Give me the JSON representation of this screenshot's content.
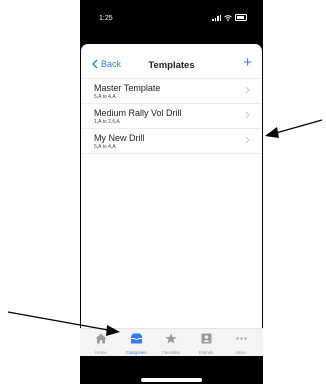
{
  "status": {
    "time": "1:25"
  },
  "nav": {
    "back_label": "Back",
    "title": "Templates",
    "add_label": "+"
  },
  "templates": [
    {
      "title": "Master Template",
      "subtitle": "5,A to 4,A"
    },
    {
      "title": "Medium Rally Vol Drill",
      "subtitle": "1,A to 2,6,A"
    },
    {
      "title": "My New Drill",
      "subtitle": "5,A to 4,A"
    }
  ],
  "tabs": [
    {
      "label": "Home",
      "icon": "home-icon"
    },
    {
      "label": "Categories",
      "icon": "categories-icon",
      "active": true
    },
    {
      "label": "Favorites",
      "icon": "star-icon"
    },
    {
      "label": "Friends",
      "icon": "friends-icon"
    },
    {
      "label": "More",
      "icon": "more-icon"
    }
  ],
  "colors": {
    "accent": "#2f7ef5",
    "inactive": "#999999",
    "frame": "#000000"
  }
}
